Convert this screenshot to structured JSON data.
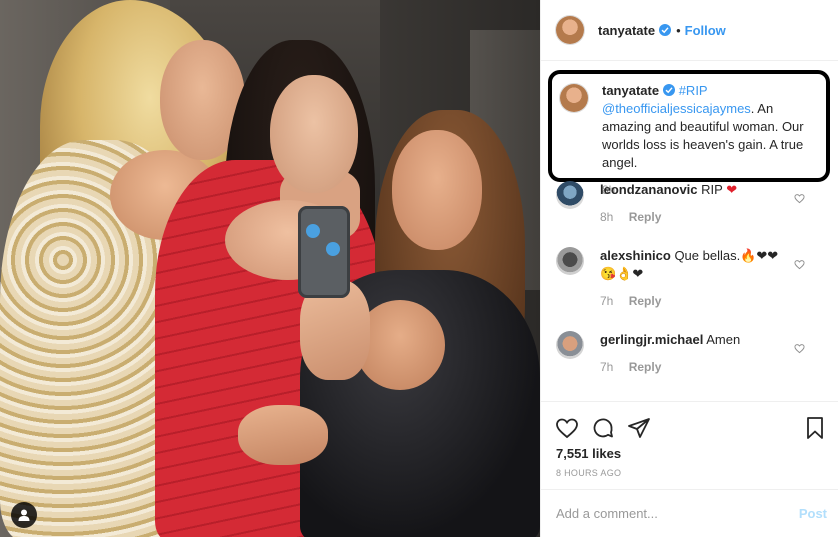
{
  "post": {
    "username": "tanyatate",
    "follow_label": "Follow",
    "separator": "•"
  },
  "caption": {
    "username": "tanyatate",
    "hashtag": "#RIP",
    "mention": "@theofficialjessicajaymes",
    "text": ". An amazing and beautiful woman. Our worlds loss is heaven's gain. A true angel.",
    "time": "8h"
  },
  "comments": [
    {
      "username": "leondzananovic",
      "text": "RIP",
      "emoji": "❤",
      "time": "8h",
      "reply_label": "Reply"
    },
    {
      "username": "alexshinico",
      "text": "Que bellas.",
      "emoji_line1": "🔥❤❤",
      "emoji_line2": "😘👌❤",
      "time": "7h",
      "reply_label": "Reply"
    },
    {
      "username": "gerlingjr.michael",
      "text": "Amen",
      "time": "7h",
      "reply_label": "Reply"
    }
  ],
  "stats": {
    "likes": "7,551 likes",
    "posted_ago": "8 HOURS AGO"
  },
  "composer": {
    "placeholder": "Add a comment...",
    "post_label": "Post"
  },
  "icons": {
    "like": "heart-icon",
    "comment": "comment-icon",
    "share": "share-icon",
    "save": "bookmark-icon",
    "tag": "user-tag-icon",
    "verified": "verified-badge-icon"
  },
  "colors": {
    "link_blue": "#3897f0",
    "muted": "#999999",
    "post_disabled": "#b2dffc",
    "heart_red": "#e0202c",
    "highlight_border": "#000000"
  }
}
